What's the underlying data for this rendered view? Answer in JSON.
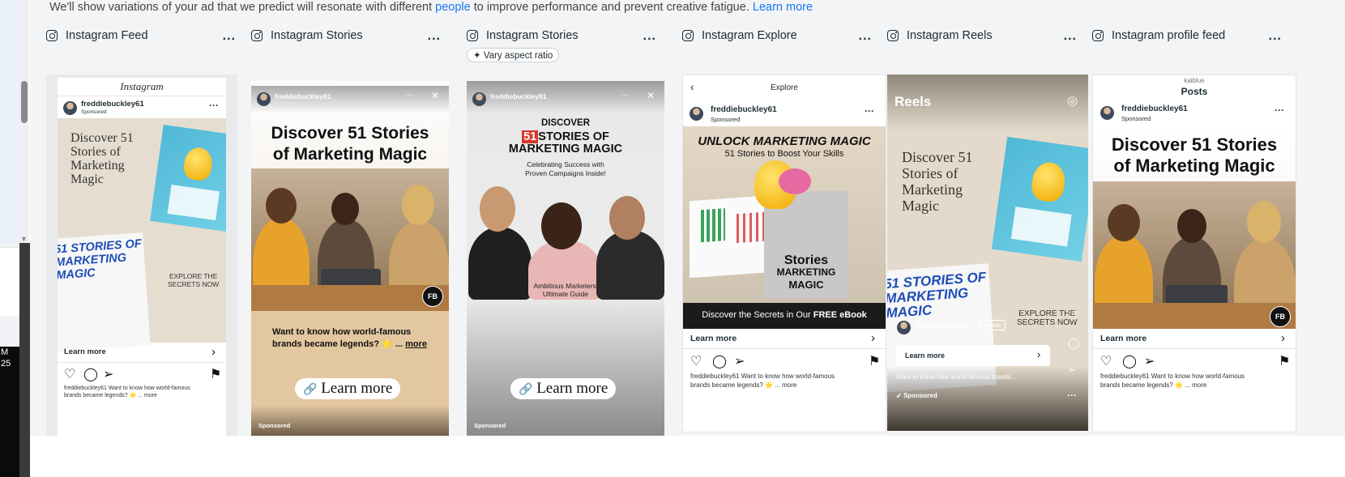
{
  "intro": {
    "text_before": "We'll show variations of your ad that we predict will resonate with different ",
    "people_link": "people",
    "text_after": " to improve performance and prevent creative fatigue. ",
    "learn_more_link": "Learn more"
  },
  "side": {
    "clock_line1": "M",
    "clock_line2": "25"
  },
  "placements": [
    {
      "title": "Instagram Feed",
      "menu": "..."
    },
    {
      "title": "Instagram Stories",
      "menu": "..."
    },
    {
      "title": "Instagram Stories",
      "menu": "...",
      "badge": "✦ Vary aspect ratio"
    },
    {
      "title": "Instagram Explore",
      "menu": "..."
    },
    {
      "title": "Instagram Reels",
      "menu": "..."
    },
    {
      "title": "Instagram profile feed",
      "menu": "..."
    }
  ],
  "feed": {
    "app_header": "Instagram",
    "username": "freddiebuckley61",
    "sponsored": "Sponsored",
    "hero_line1": "Discover 51",
    "hero_line2": "Stories of",
    "hero_line3": "Marketing",
    "hero_line4": "Magic",
    "book_line1": "51 STORIES OF",
    "book_line2": "MARKETING",
    "book_line3": "MAGIC",
    "explore_line1": "EXPLORE THE",
    "explore_line2": "SECRETS NOW",
    "cta": "Learn more",
    "caption_line1": "freddiebuckley61 Want to know how world-famous",
    "caption_line2": "brands became legends? 🌟 ... more"
  },
  "story1": {
    "username": "freddiebuckley61",
    "headline_line1": "Discover 51 Stories",
    "headline_line2": "of Marketing Magic",
    "badge": "FB",
    "body_line1": "Want to know how world-famous",
    "body_line2": "brands became legends? 🌟 ...",
    "more": "more",
    "cta": "Learn more",
    "sponsored": "Sponsored"
  },
  "story2": {
    "username": "freddiebuckley61",
    "discover": "DISCOVER",
    "num": "51",
    "title_line1": "STORIES OF",
    "title_line2": "MARKETING MAGIC",
    "sub_line1": "Celebrating Success with",
    "sub_line2": "Proven Campaigns Inside!",
    "foot_line1": "Ambitious Marketers'",
    "foot_line2": "Ultimate Guide",
    "cta": "Learn more",
    "sponsored": "Sponsored"
  },
  "explore": {
    "header": "Explore",
    "username": "freddiebuckley61",
    "sponsored": "Sponsored",
    "headline": "UNLOCK MARKETING MAGIC",
    "subline": "51 Stories to Boost Your Skills",
    "book_title1": "Stories",
    "book_title2": "MARKETING",
    "book_title3": "MAGIC",
    "strip_text": "Discover the Secrets in Our ",
    "strip_bold": "FREE eBook",
    "cta": "Learn more",
    "caption_line1": "freddiebuckley61 Want to know how world-famous",
    "caption_line2": "brands became legends? 🌟 ... more"
  },
  "reels": {
    "title": "Reels",
    "hero_line1": "Discover 51",
    "hero_line2": "Stories of",
    "hero_line3": "Marketing",
    "hero_line4": "Magic",
    "book_line1": "51 STORIES OF",
    "book_line2": "MARKETING",
    "book_line3": "MAGIC",
    "explore_line1": "EXPLORE THE",
    "explore_line2": "SECRETS NOW",
    "username": "freddiebuckley61",
    "follow": "Follow",
    "cta": "Learn more",
    "caption": "Want to know how world-famous brands ...",
    "sponsored": "Sponsored"
  },
  "profile": {
    "handle": "kaiblue",
    "section": "Posts",
    "username": "freddiebuckley61",
    "sponsored": "Sponsored",
    "headline_line1": "Discover 51 Stories",
    "headline_line2": "of Marketing Magic",
    "badge": "FB",
    "cta": "Learn more",
    "caption_line1": "freddiebuckley61 Want to know how world-famous",
    "caption_line2": "brands became legends? 🌟 ... more"
  }
}
